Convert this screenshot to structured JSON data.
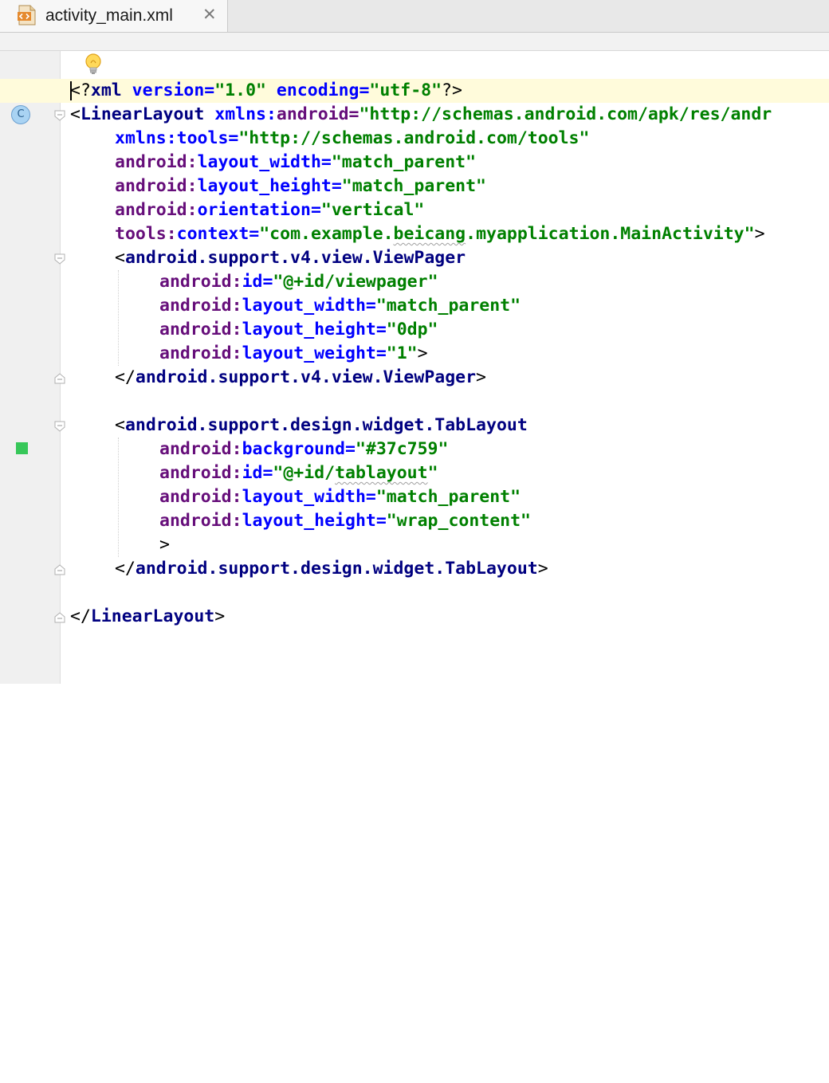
{
  "tab": {
    "title": "activity_main.xml",
    "close": "✕",
    "icon": "xml-file-icon"
  },
  "gutter": {
    "class_marker": "C",
    "color_swatch": "#37c759",
    "intention_icon": "lightbulb-icon"
  },
  "code": {
    "l1": {
      "open": "<?",
      "tag": "xml",
      "a1": " version=",
      "v1": "\"1.0\"",
      "a2": " encoding=",
      "v2": "\"utf-8\"",
      "close": "?>"
    },
    "l2": {
      "open": "<",
      "tag": "LinearLayout",
      "sp": " ",
      "ns": "xmlns:",
      "attr": "android=",
      "val": "\"http://schemas.android.com/apk/res/andr"
    },
    "l3": {
      "ns": "xmlns:",
      "attr": "tools=",
      "val": "\"http://schemas.android.com/tools\""
    },
    "l4": {
      "ns": "android:",
      "attr": "layout_width=",
      "val": "\"match_parent\""
    },
    "l5": {
      "ns": "android:",
      "attr": "layout_height=",
      "val": "\"match_parent\""
    },
    "l6": {
      "ns": "android:",
      "attr": "orientation=",
      "val": "\"vertical\""
    },
    "l7": {
      "ns": "tools:",
      "attr": "context=",
      "val_a": "\"com.example.",
      "val_squig": "beicang",
      "val_b": ".myapplication.MainActivity\"",
      "close": ">"
    },
    "l8": {
      "open": "<",
      "tag": "android.support.v4.view.ViewPager"
    },
    "l9": {
      "ns": "android:",
      "attr": "id=",
      "val": "\"@+id/viewpager\""
    },
    "l10": {
      "ns": "android:",
      "attr": "layout_width=",
      "val": "\"match_parent\""
    },
    "l11": {
      "ns": "android:",
      "attr": "layout_height=",
      "val": "\"0dp\""
    },
    "l12": {
      "ns": "android:",
      "attr": "layout_weight=",
      "val": "\"1\"",
      "close": ">"
    },
    "l13": {
      "open": "</",
      "tag": "android.support.v4.view.ViewPager",
      "close": ">"
    },
    "l15": {
      "open": "<",
      "tag": "android.support.design.widget.TabLayout"
    },
    "l16": {
      "ns": "android:",
      "attr": "background=",
      "val": "\"#37c759\""
    },
    "l17": {
      "ns": "android:",
      "attr": "id=",
      "val_a": "\"@+id/",
      "val_squig": "tablayout",
      "val_b": "\""
    },
    "l18": {
      "ns": "android:",
      "attr": "layout_width=",
      "val": "\"match_parent\""
    },
    "l19": {
      "ns": "android:",
      "attr": "layout_height=",
      "val": "\"wrap_content\""
    },
    "l20": {
      "close": ">"
    },
    "l21": {
      "open": "</",
      "tag": "android.support.design.widget.TabLayout",
      "close": ">"
    },
    "l23": {
      "open": "</",
      "tag": "LinearLayout",
      "close": ">"
    }
  }
}
